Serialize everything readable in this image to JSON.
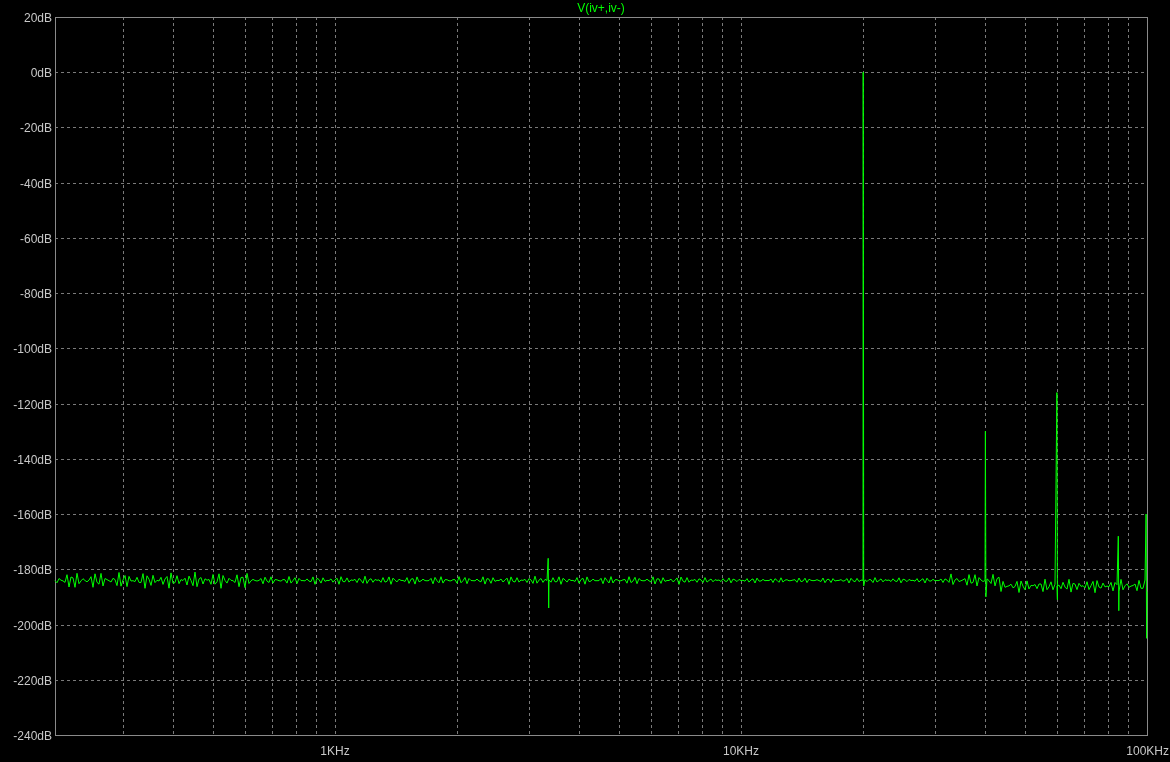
{
  "plot": {
    "trace_name": "V(iv+,iv-)",
    "y_axis_labels": [
      "20dB",
      "0dB",
      "-20dB",
      "-40dB",
      "-60dB",
      "-80dB",
      "-100dB",
      "-120dB",
      "-140dB",
      "-160dB",
      "-180dB",
      "-200dB",
      "-220dB",
      "-240dB"
    ],
    "x_axis_labels": [
      "1KHz",
      "10KHz",
      "100KHz"
    ]
  }
}
